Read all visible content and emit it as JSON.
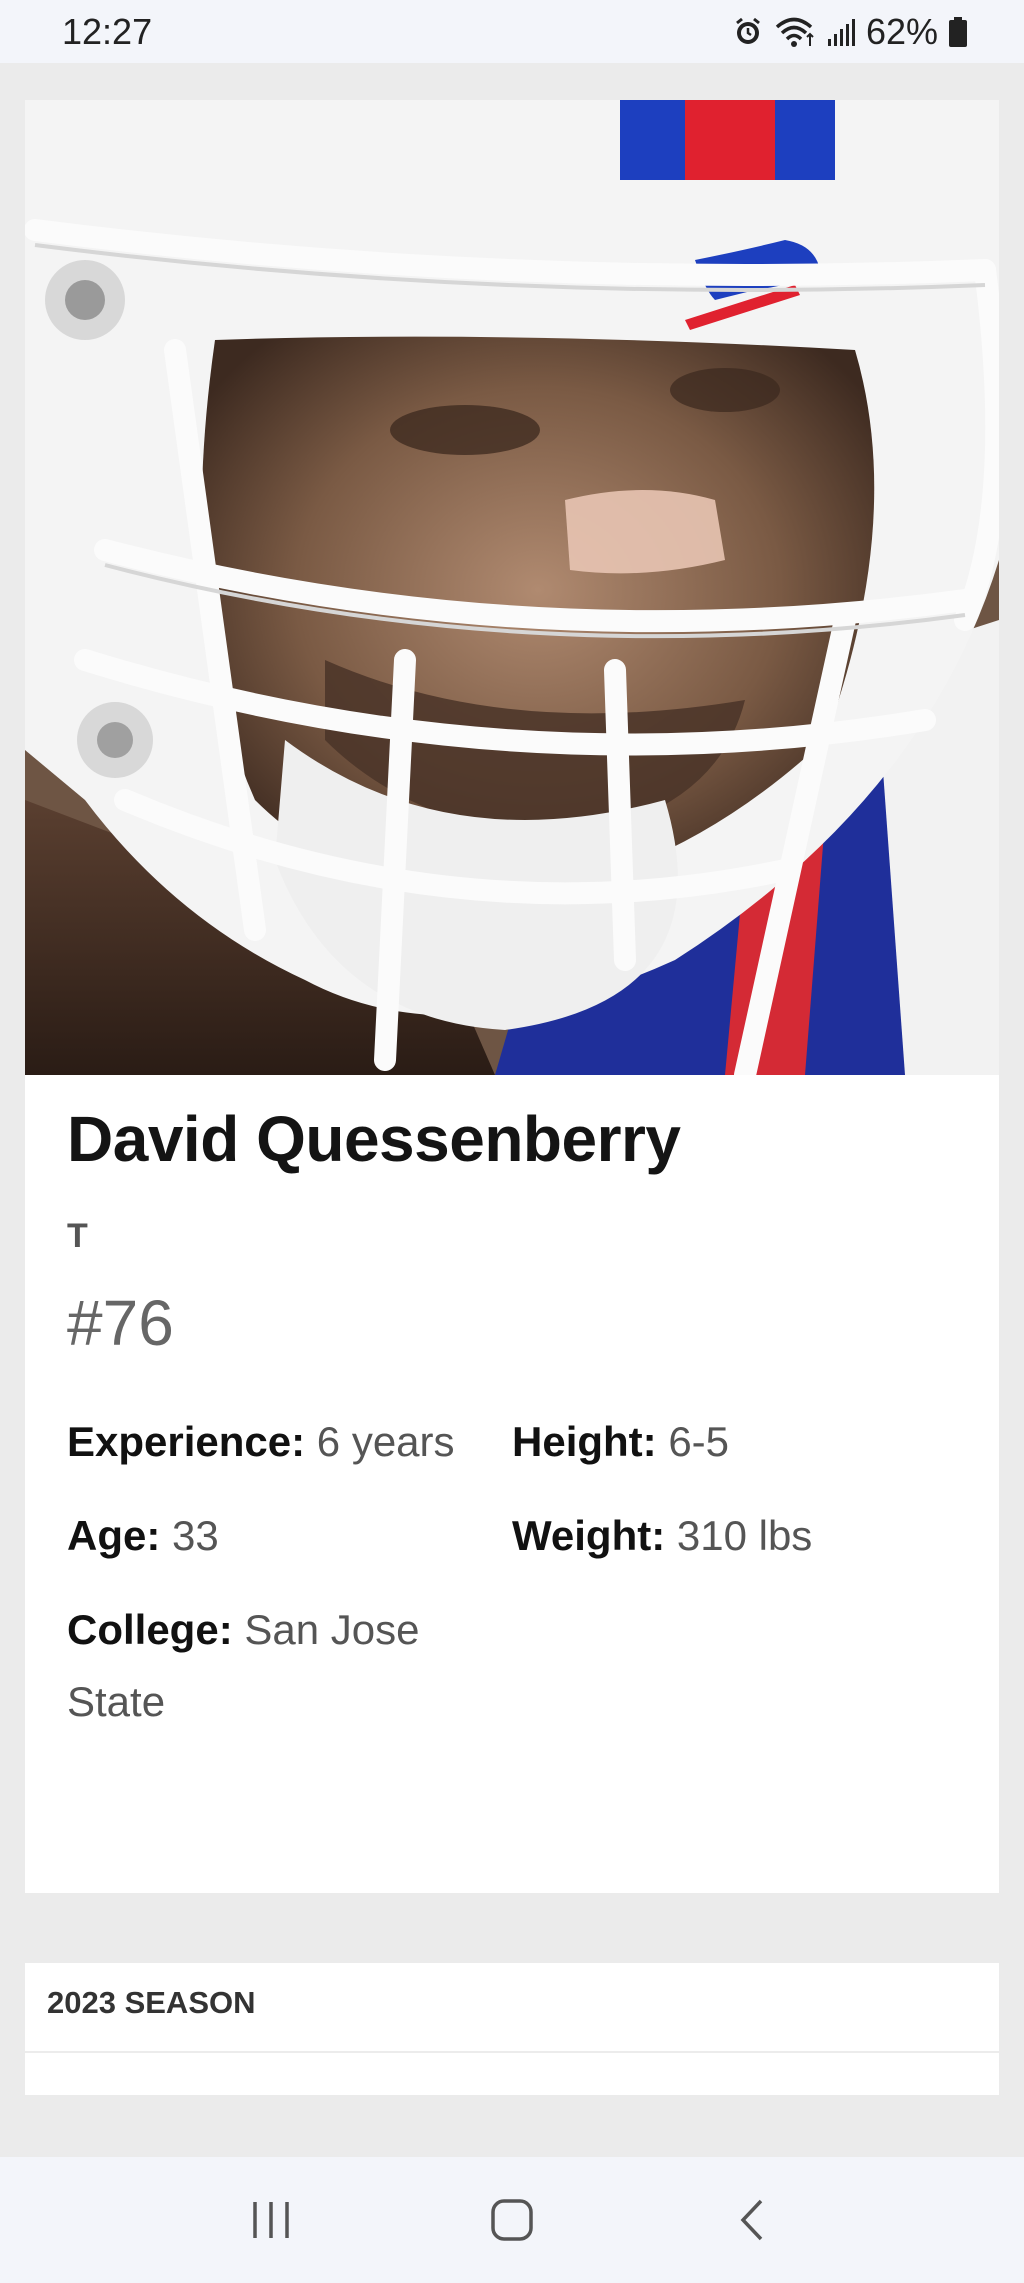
{
  "status_bar": {
    "time": "12:27",
    "battery": "62%"
  },
  "player": {
    "name": "David Quessenberry",
    "position": "T",
    "number": "#76",
    "stats": {
      "experience_label": "Experience:",
      "experience_value": "6 years",
      "height_label": "Height:",
      "height_value": "6-5",
      "age_label": "Age:",
      "age_value": "33",
      "weight_label": "Weight:",
      "weight_value": "310 lbs",
      "college_label": "College:",
      "college_value": "San Jose State"
    }
  },
  "season": {
    "label": "2023 SEASON"
  },
  "colors": {
    "team_blue": "#1d3fbf",
    "team_red": "#e0212f"
  }
}
